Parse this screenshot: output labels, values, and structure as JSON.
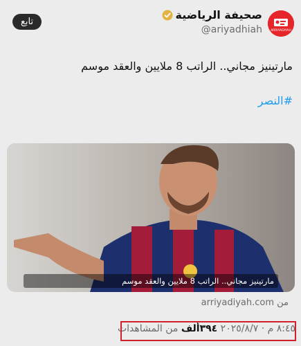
{
  "account": {
    "display_name": "صحيفة الرياضية",
    "handle": "@ariyadhiah",
    "logo_caption": "ARRIYADIYAH"
  },
  "follow_label": "تابع",
  "tweet": {
    "text": "مارتينيز مجاني.. الراتب 8 ملايين والعقد موسم",
    "hashtag": "#النصر"
  },
  "card": {
    "caption": "مارتينيز مجاني.. الراتب 8 ملايين والعقد موسم"
  },
  "source": {
    "prefix": "من",
    "domain": "arriyadiyah.com"
  },
  "meta": {
    "time": "٨:٤٥ م",
    "separator": "·",
    "date": "٢٠٢٥/٨/٧",
    "views_count": "٣٩٤ألف",
    "views_label": "من المشاهدات"
  },
  "colors": {
    "accent": "#1d9bf0",
    "brand": "#e5252a",
    "highlight_box": "#d0202a"
  }
}
